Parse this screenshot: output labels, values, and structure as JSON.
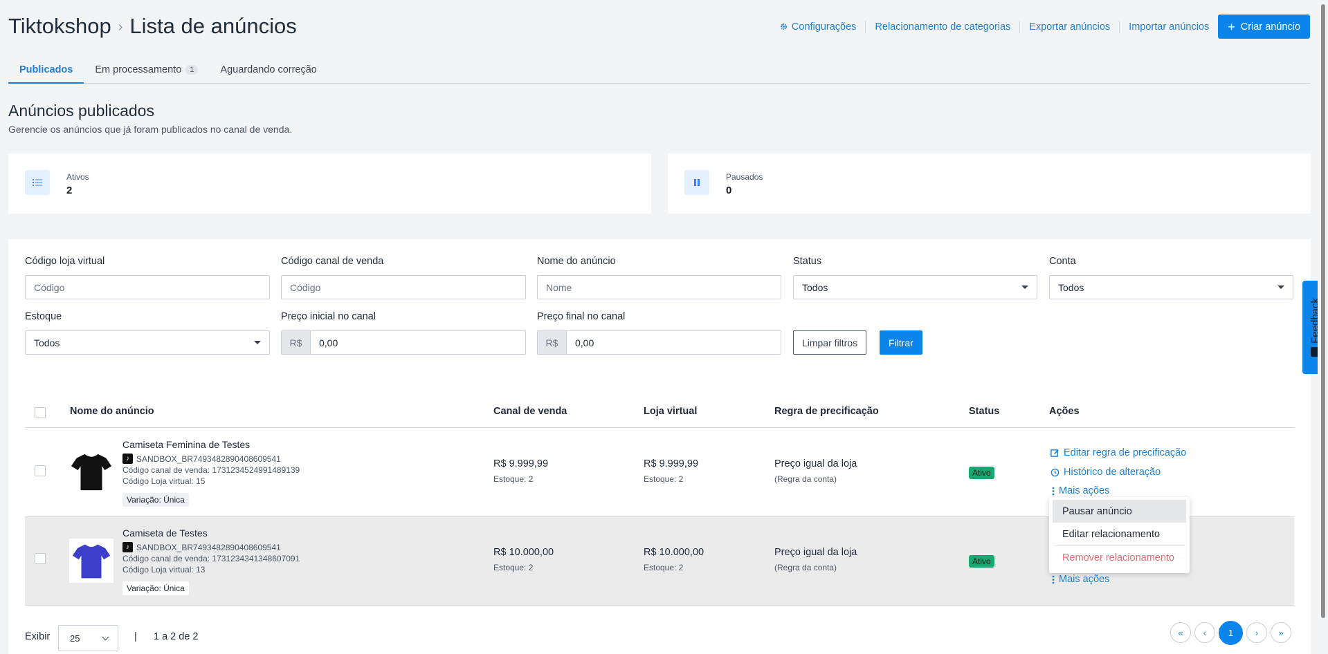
{
  "header": {
    "breadcrumb_root": "Tiktokshop",
    "breadcrumb_sep": "›",
    "page_title": "Lista de anúncios",
    "links": [
      "Configurações",
      "Relacionamento de categorias",
      "Exportar anúncios",
      "Importar anúncios"
    ],
    "create_label": "Criar anúncio"
  },
  "tabs": [
    {
      "label": "Publicados"
    },
    {
      "label": "Em processamento",
      "badge": "1"
    },
    {
      "label": "Aguardando correção"
    }
  ],
  "section": {
    "title": "Anúncios publicados",
    "subtitle": "Gerencie os anúncios que já foram publicados no canal de venda."
  },
  "stats": [
    {
      "label": "Ativos",
      "value": "2"
    },
    {
      "label": "Pausados",
      "value": "0"
    }
  ],
  "filters": {
    "codigo_loja": {
      "label": "Código loja virtual",
      "placeholder": "Código"
    },
    "codigo_canal": {
      "label": "Código canal de venda",
      "placeholder": "Código"
    },
    "nome": {
      "label": "Nome do anúncio",
      "placeholder": "Nome"
    },
    "status": {
      "label": "Status",
      "value": "Todos"
    },
    "conta": {
      "label": "Conta",
      "value": "Todos"
    },
    "estoque": {
      "label": "Estoque",
      "value": "Todos"
    },
    "preco_inicial": {
      "label": "Preço inicial no canal",
      "prefix": "R$",
      "value": "0,00"
    },
    "preco_final": {
      "label": "Preço final no canal",
      "prefix": "R$",
      "value": "0,00"
    },
    "clear_label": "Limpar filtros",
    "filter_label": "Filtrar"
  },
  "table": {
    "headers": {
      "nome": "Nome do anúncio",
      "canal": "Canal de venda",
      "loja": "Loja virtual",
      "regra": "Regra de precificação",
      "status": "Status",
      "acoes": "Ações"
    },
    "rows": [
      {
        "name": "Camiseta Feminina de Testes",
        "sku": "SANDBOX_BR7493482890408609541",
        "codigo_canal": "Código canal de venda: 1731234524991489139",
        "codigo_loja": "Código Loja virtual: 15",
        "variacao": "Variação: Única",
        "preco_canal": "R$ 9.999,99",
        "estoque_canal": "Estoque: 2",
        "preco_loja": "R$ 9.999,99",
        "estoque_loja": "Estoque: 2",
        "regra": "Preço igual da loja",
        "regra_sub": "(Regra da conta)",
        "status": "Ativo",
        "shirt_color": "#111111"
      },
      {
        "name": "Camiseta de Testes",
        "sku": "SANDBOX_BR7493482890408609541",
        "codigo_canal": "Código canal de venda: 1731234341348607091",
        "codigo_loja": "Código Loja virtual: 13",
        "variacao": "Variação: Única",
        "preco_canal": "R$ 10.000,00",
        "estoque_canal": "Estoque: 2",
        "preco_loja": "R$ 10.000,00",
        "estoque_loja": "Estoque: 2",
        "regra": "Preço igual da loja",
        "regra_sub": "(Regra da conta)",
        "status": "Ativo",
        "shirt_color": "#3b3fc9"
      }
    ],
    "actions": {
      "edit_rule": "Editar regra de precificação",
      "history": "Histórico de alteração",
      "more": "Mais ações"
    },
    "dropdown": [
      "Pausar anúncio",
      "Editar relacionamento",
      "Remover relacionamento"
    ]
  },
  "footer": {
    "exibir": "Exibir",
    "per_page": "25",
    "pipe": "|",
    "range": "1 a 2 de 2",
    "pager": [
      "«",
      "‹",
      "1",
      "›",
      "»"
    ]
  },
  "feedback_label": "Feedback",
  "colors": {
    "accent": "#0b85ea",
    "link": "#1f7fd4",
    "status_active": "#1aa772",
    "danger": "#e06b73"
  }
}
